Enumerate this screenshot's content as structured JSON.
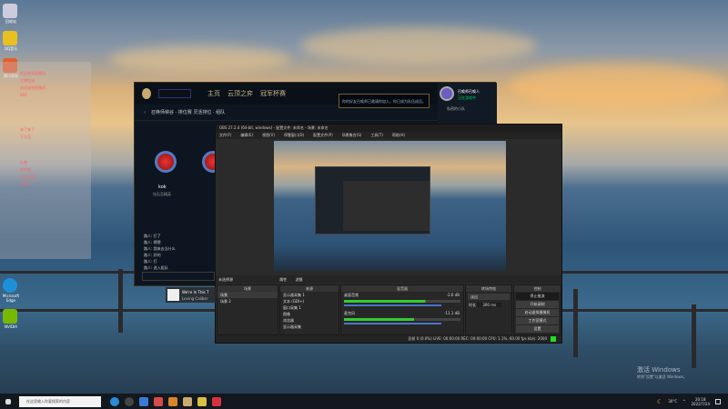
{
  "desktop": {
    "icons": [
      "回收站",
      "QQ音乐",
      "腾讯视频",
      "Microsoft Edge",
      "NVIDIA"
    ],
    "activate": {
      "title": "激活 Windows",
      "subtitle": "转到\"设置\"以激活 Windows。"
    }
  },
  "chat": {
    "lines": [
      "欢迎来到直播间",
      "主播加油",
      "欢迎来到直播间",
      "666",
      "来了来了",
      "下次见",
      "礼物",
      "哈哈哈",
      "关注主播",
      "冲冲冲"
    ]
  },
  "lol": {
    "nav": [
      "主页",
      "云顶之弈",
      "冠军杯赛"
    ],
    "breadcrumb": "召唤师峡谷 · 排位赛 灵活排位 · 组队",
    "notice": "你的好友召唤师已邀请你加入，你已成为队伍成员。",
    "profile": {
      "name": "召唤师召唤人",
      "status": "正在游戏中"
    },
    "social": "私密的小队",
    "player": {
      "name": "kok",
      "rank": "钻石至精英"
    },
    "chat": [
      "路人: 打了",
      "路人: 嗯嗯",
      "路人: 我来去当什么",
      "路人: 好的",
      "路人: 打",
      "路人: 进入组队"
    ]
  },
  "obs": {
    "title": "OBS 27.2.4 (64-bit, windows) - 配置文件: 未命名 - 场景: 未命名",
    "menu": [
      "文件(F)",
      "编辑(E)",
      "视图(V)",
      "停靠窗口(D)",
      "配置文件(P)",
      "场景集合(S)",
      "工具(T)",
      "帮助(H)"
    ],
    "no_source": "未选择源",
    "props_label": "属性",
    "filters_label": "滤镜",
    "docks": {
      "scenes": "场景",
      "sources": "来源",
      "mixer": "混音器",
      "transitions": "转场特效",
      "controls": "控制"
    },
    "scenes": [
      "场景",
      "场景 2"
    ],
    "sources": [
      "显示器采集 1",
      "文本 (GDI+)",
      "窗口采集 1",
      "图像",
      "浏览器",
      "显示器采集"
    ],
    "mixer": [
      {
        "name": "桌面音频",
        "db": "-2.6 dB",
        "level": 0.7
      },
      {
        "name": "麦克风",
        "db": "-11.1 dB",
        "level": 0.6
      }
    ],
    "transition": {
      "type": "淡出",
      "duration_label": "时长",
      "duration": "300 ms"
    },
    "controls": [
      "停止推流",
      "开始录制",
      "启动虚拟摄像机",
      "工作室模式",
      "设置",
      "退出"
    ],
    "status": "丢帧 0 (0.0%)   LIVE: 00:00:00   REC: 00:00:00   CPU: 1.1%, 60.00 fps   kb/s: 2000"
  },
  "media": {
    "title": "We're In This T",
    "artist": "Loving Caliber"
  },
  "taskbar": {
    "search_placeholder": "在这里输入你要搜索的内容",
    "weather": "30°C",
    "time": "20:18",
    "date": "2022/7/24"
  },
  "colors": {
    "accent_green": "#22dd22",
    "lol_gold": "#c8aa6e"
  }
}
